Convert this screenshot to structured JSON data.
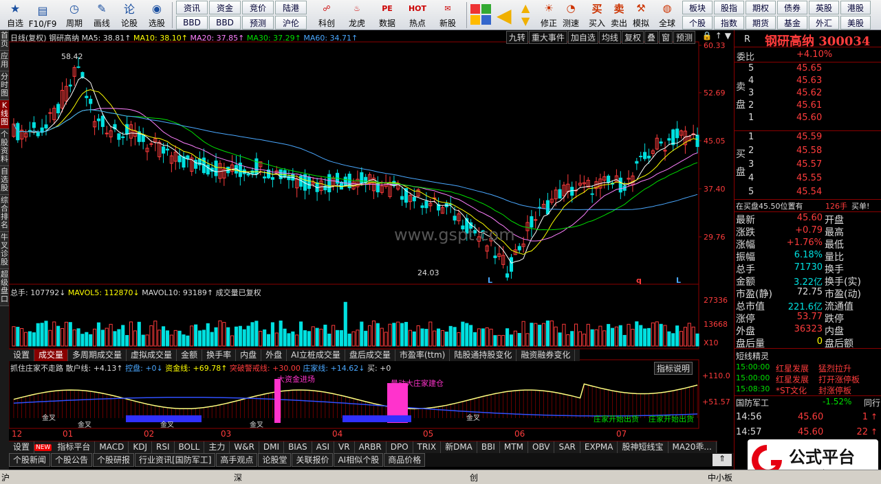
{
  "toolbar": {
    "buttons": [
      {
        "label": "自选",
        "icon": "star-icon"
      },
      {
        "label": "F10/F9",
        "icon": "f10-icon"
      },
      {
        "label": "周期",
        "icon": "clock-icon"
      },
      {
        "label": "画线",
        "icon": "pencil-icon"
      },
      {
        "label": "论股",
        "icon": "lungu-icon"
      },
      {
        "label": "选股",
        "icon": "select-stock-icon"
      }
    ],
    "pairs": [
      [
        "资讯",
        "BBD"
      ],
      [
        "资金",
        "BBD"
      ],
      [
        "竞价",
        "预测"
      ],
      [
        "陆港",
        "沪伦"
      ]
    ],
    "pairs_fixed": [
      [
        "资讯",
        "BBD"
      ],
      [
        "资金",
        "BBD"
      ],
      [
        "竞价",
        "预测"
      ],
      [
        "陆港",
        "沪伦"
      ]
    ],
    "buttons2": [
      {
        "label": "科创",
        "icon": "kechuang-icon"
      },
      {
        "label": "龙虎",
        "icon": "dragon-tiger-icon"
      },
      {
        "label": "数据",
        "icon": "pe-icon"
      },
      {
        "label": "热点",
        "icon": "hot-icon"
      },
      {
        "label": "新股",
        "icon": "new-stock-icon"
      }
    ],
    "buttons3": [
      {
        "label": "修正",
        "icon": "bulb-icon"
      },
      {
        "label": "测速",
        "icon": "speed-icon"
      },
      {
        "label": "买入",
        "icon": "buy-icon"
      },
      {
        "label": "卖出",
        "icon": "sell-icon"
      },
      {
        "label": "模拟",
        "icon": "hammer-icon"
      },
      {
        "label": "全球",
        "icon": "globe-icon"
      }
    ],
    "right_pairs": [
      [
        "板块",
        "个股"
      ],
      [
        "股指",
        "指数"
      ],
      [
        "期权",
        "期货"
      ],
      [
        "债券",
        "基金"
      ],
      [
        "英股",
        "外汇"
      ],
      [
        "港股",
        "美股"
      ]
    ]
  },
  "left_tabs": [
    "首页",
    "应用",
    "分时图",
    "K线图",
    "个股资料",
    "自选股",
    "综合排名",
    "牛叉诊股",
    "超级盘口"
  ],
  "chart_header": {
    "title": "日线(复权)",
    "name": "钢研高纳",
    "ma5": "MA5: 38.81↑",
    "ma10": "MA10: 38.10↑",
    "ma20": "MA20: 37.85↑",
    "ma30": "MA30: 37.29↑",
    "ma60": "MA60: 34.71↑",
    "buttons": [
      "九转",
      "重大事件",
      "加自选",
      "均线",
      "复权",
      "叠",
      "窗",
      "预测"
    ]
  },
  "price_axis": [
    "60.33",
    "52.69",
    "45.05",
    "37.40",
    "29.76"
  ],
  "annotations": {
    "high": "58.42",
    "low": "24.03",
    "marks": [
      "L",
      "q",
      "L"
    ]
  },
  "vol_header": {
    "total": "总手: 107792↓",
    "mavol5": "MAVOL5: 112870↓",
    "mavol10": "MAVOL10: 93189↑",
    "note": "成交量已复权"
  },
  "vol_axis": [
    "27336",
    "13668",
    "X10"
  ],
  "vol_tabs": [
    "设置",
    "成交量",
    "多周期成交量",
    "虚拟成交量",
    "金额",
    "换手率",
    "内盘",
    "外盘",
    "AI立桩成交量",
    "盘后成交量",
    "市盈率(ttm)",
    "陆股通持股变化",
    "融资融券变化"
  ],
  "ind_header": {
    "title": "抓住庄家不走路",
    "scatter": "散户线: +4.13↑",
    "control": "控盘: +0↓",
    "fund": "资金线: +69.78↑",
    "warn": "突破警戒线: +30.00",
    "dealer": "庄家线: +14.62↓",
    "buy": "买: +0",
    "explain": "指标说明"
  },
  "ind_axis": [
    "+110.0",
    "+51.57"
  ],
  "ind_labels": [
    "大资金进场",
    "量动大庄家建仓",
    "庄家开始出货",
    "庄家开始出货"
  ],
  "ind_small_labels": [
    "金叉",
    "金叉",
    "金叉",
    "金叉",
    "金叉"
  ],
  "time_axis": [
    "12",
    "01",
    "02",
    "03",
    "04",
    "05",
    "06",
    "07"
  ],
  "ind_tabs": [
    "设置",
    "NEW",
    "指标平台",
    "MACD",
    "KDJ",
    "RSI",
    "BOLL",
    "主力",
    "W&R",
    "DMI",
    "BIAS",
    "ASI",
    "VR",
    "ARBR",
    "DPO",
    "TRIX",
    "新DMA",
    "BBI",
    "MTM",
    "OBV",
    "SAR",
    "EXPMA",
    "股神短线宝",
    "MA20乖..."
  ],
  "news_tabs": [
    "个股新闻",
    "个股公告",
    "个股研报",
    "行业资讯[国防军工]",
    "高手观点",
    "论股堂",
    "关联报价",
    "AI相似个股",
    "商品价格"
  ],
  "right_panel": {
    "code": "R",
    "name": "钢研高纳 300034",
    "weibi": {
      "label": "委比",
      "value": "+4.10%"
    },
    "sell": {
      "label": "卖盘",
      "rows": [
        {
          "n": "5",
          "p": "45.65"
        },
        {
          "n": "4",
          "p": "45.63"
        },
        {
          "n": "3",
          "p": "45.62"
        },
        {
          "n": "2",
          "p": "45.61"
        },
        {
          "n": "1",
          "p": "45.60"
        }
      ]
    },
    "buy": {
      "label": "买盘",
      "rows": [
        {
          "n": "1",
          "p": "45.59"
        },
        {
          "n": "2",
          "p": "45.58"
        },
        {
          "n": "3",
          "p": "45.57"
        },
        {
          "n": "4",
          "p": "45.55"
        },
        {
          "n": "5",
          "p": "45.54"
        }
      ]
    },
    "notice": "在买盘45.50位置有",
    "notice_qty": "126手",
    "notice_act": "买单!",
    "stats": [
      {
        "l1": "最新",
        "v1": "45.60",
        "c1": "red",
        "l2": "开盘",
        "v2": ""
      },
      {
        "l1": "涨跌",
        "v1": "+0.79",
        "c1": "red",
        "l2": "最高",
        "v2": ""
      },
      {
        "l1": "涨幅",
        "v1": "+1.76%",
        "c1": "red",
        "l2": "最低",
        "v2": ""
      },
      {
        "l1": "振幅",
        "v1": "6.18%",
        "c1": "cyan",
        "l2": "量比",
        "v2": ""
      },
      {
        "l1": "总手",
        "v1": "71730",
        "c1": "cyan",
        "l2": "换手",
        "v2": ""
      },
      {
        "l1": "金额",
        "v1": "3.22亿",
        "c1": "cyan",
        "l2": "换手(实)",
        "v2": ""
      },
      {
        "l1": "市盈(静)",
        "v1": "72.75",
        "c1": "white",
        "l2": "市盈(动)",
        "v2": ""
      },
      {
        "l1": "总市值",
        "v1": "221.6亿",
        "c1": "cyan",
        "l2": "流通值",
        "v2": ""
      },
      {
        "l1": "涨停",
        "v1": "53.77",
        "c1": "red",
        "l2": "跌停",
        "v2": ""
      },
      {
        "l1": "外盘",
        "v1": "36323",
        "c1": "red",
        "l2": "内盘",
        "v2": ""
      },
      {
        "l1": "盘后量",
        "v1": "0",
        "c1": "yellow",
        "l2": "盘后额",
        "v2": ""
      }
    ],
    "shortline_title": "短线精灵",
    "shortline": [
      {
        "t": "15:00:00",
        "n": "红星发展",
        "e": "猛烈拉升"
      },
      {
        "t": "15:00:00",
        "n": "红星发展",
        "e": "打开涨停板"
      },
      {
        "t": "15:08:30",
        "n": "*ST文化",
        "e": "封涨停板"
      }
    ],
    "sector": {
      "name": "国防军工",
      "chg": "-1.52%",
      "tail": "同行"
    },
    "ticks": [
      {
        "t": "14:56",
        "p": "45.60",
        "q": "1"
      },
      {
        "t": "14:57",
        "p": "45.60",
        "q": "22"
      }
    ]
  },
  "status_bar": [
    "沪",
    "深",
    "创",
    "中小板"
  ],
  "watermark": "www.gspt.com",
  "logo": {
    "text": "公式平台",
    "url": "www.gspt.com"
  },
  "colors": {
    "up": "#ff3c3c",
    "down": "#00e0e0",
    "ma5": "#ffffff",
    "ma10": "#ffff00",
    "ma20": "#ff80ff",
    "ma30": "#00e000",
    "ma60": "#4aa8ff"
  }
}
